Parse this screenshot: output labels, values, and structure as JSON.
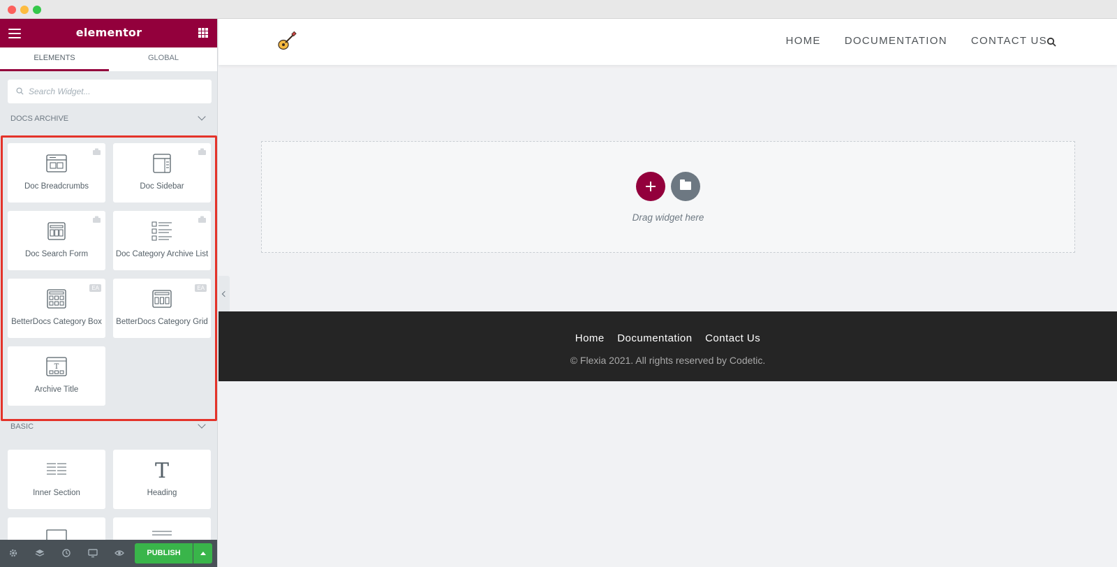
{
  "panel": {
    "brand": "elementor",
    "tabs": [
      {
        "label": "ELEMENTS"
      },
      {
        "label": "GLOBAL"
      }
    ],
    "search_placeholder": "Search Widget...",
    "categories": {
      "docs_archive": {
        "title": "DOCS ARCHIVE",
        "widgets": [
          {
            "label": "Doc Breadcrumbs",
            "badge": "pro"
          },
          {
            "label": "Doc Sidebar",
            "badge": "pro"
          },
          {
            "label": "Doc Search Form",
            "badge": "pro"
          },
          {
            "label": "Doc Category Archive List",
            "badge": "pro"
          },
          {
            "label": "BetterDocs Category Box",
            "badge": "EA"
          },
          {
            "label": "BetterDocs Category Grid",
            "badge": "EA"
          },
          {
            "label": "Archive Title",
            "badge": ""
          }
        ]
      },
      "basic": {
        "title": "BASIC",
        "widgets": [
          {
            "label": "Inner Section"
          },
          {
            "label": "Heading"
          }
        ]
      }
    },
    "footer": {
      "publish_label": "PUBLISH"
    },
    "colors": {
      "brand": "#93003c",
      "publish": "#39b54a",
      "highlight": "#e4332a"
    }
  },
  "site": {
    "nav": [
      "HOME",
      "DOCUMENTATION",
      "CONTACT US"
    ],
    "dropzone_text": "Drag widget here",
    "footer_nav": [
      "Home",
      "Documentation",
      "Contact Us"
    ],
    "copyright": "© Flexia 2021. All rights reserved by Codetic."
  }
}
